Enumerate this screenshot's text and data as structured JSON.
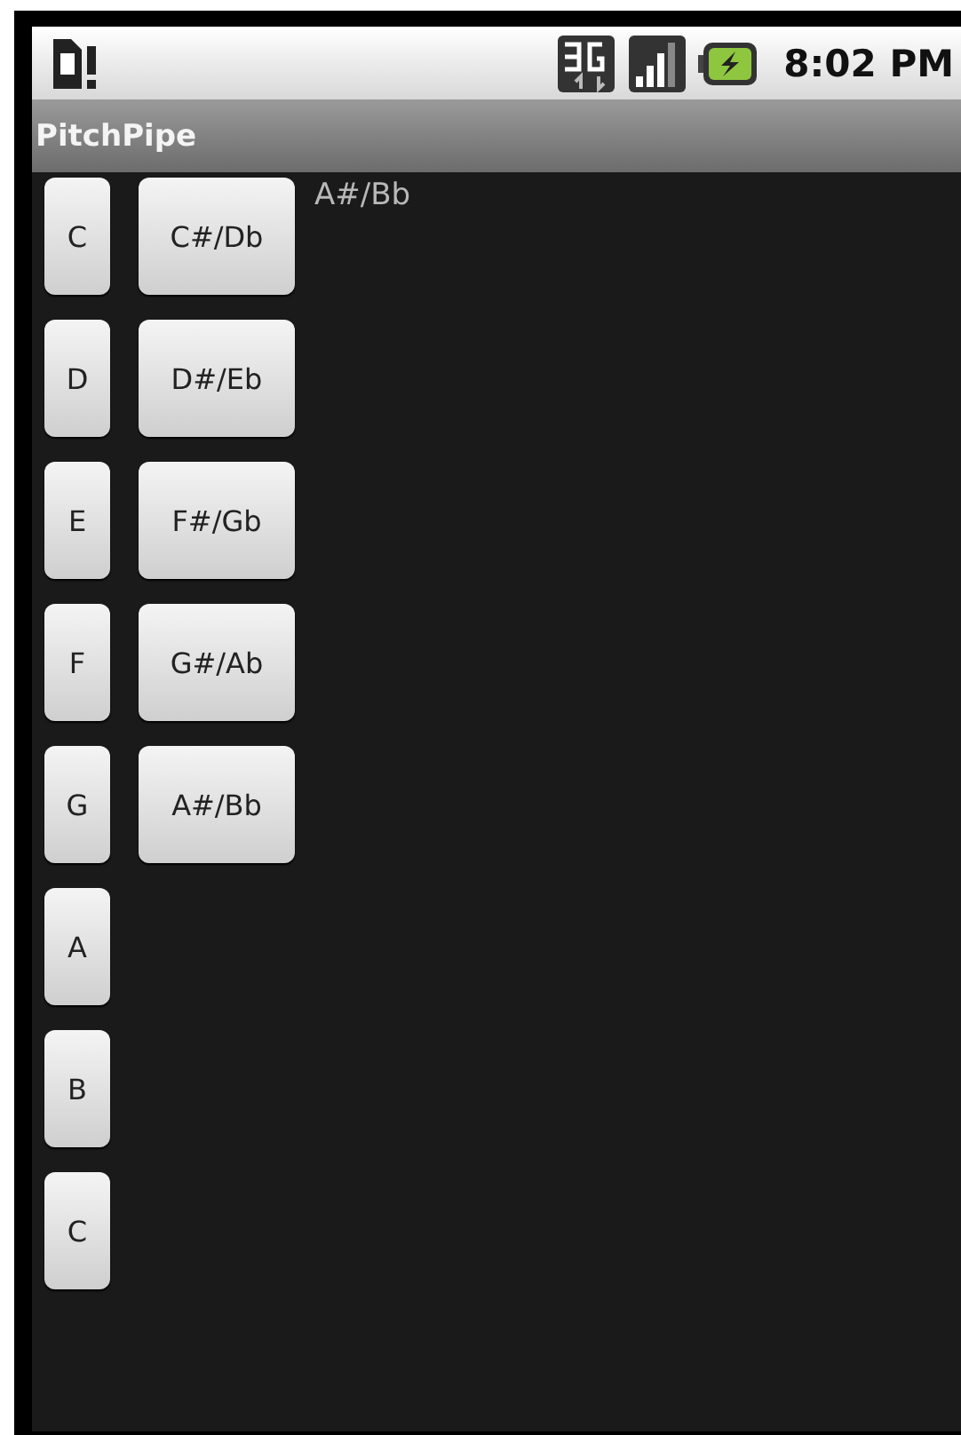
{
  "status_bar": {
    "time": "8:02 PM"
  },
  "title_bar": {
    "title": "PitchPipe"
  },
  "natural_keys": [
    "C",
    "D",
    "E",
    "F",
    "G",
    "A",
    "B",
    "C"
  ],
  "sharp_keys": [
    "C#/Db",
    "D#/Eb",
    "F#/Gb",
    "G#/Ab",
    "A#/Bb"
  ],
  "current_note": "A#/Bb"
}
